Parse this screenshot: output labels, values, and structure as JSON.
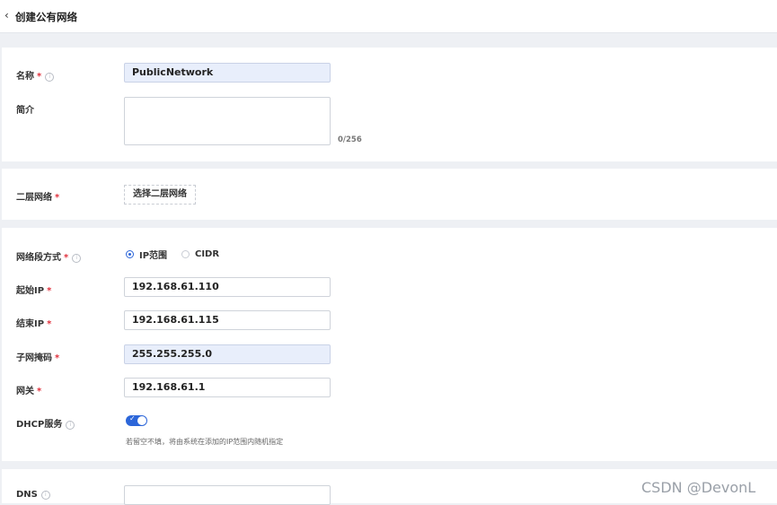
{
  "header": {
    "back_icon": "‹",
    "title": "创建公有网络"
  },
  "basic": {
    "name_label": "名称",
    "name_value": "PublicNetwork",
    "desc_label": "简介",
    "desc_value": "",
    "desc_counter": "0/256"
  },
  "l2": {
    "label": "二层网络",
    "button": "选择二层网络"
  },
  "range": {
    "mode_label": "网络段方式",
    "mode_options": [
      "IP范围",
      "CIDR"
    ],
    "mode_selected": "IP范围",
    "start_label": "起始IP",
    "start_value": "192.168.61.110",
    "end_label": "结束IP",
    "end_value": "192.168.61.115",
    "mask_label": "子网掩码",
    "mask_value": "255.255.255.0",
    "gateway_label": "网关",
    "gateway_value": "192.168.61.1",
    "dhcp_label": "DHCP服务",
    "dhcp_enabled": true,
    "dhcp_hint": "若留空不填，将由系统在添加的IP范围内随机指定"
  },
  "dns": {
    "label": "DNS",
    "value": ""
  },
  "required_mark": "*",
  "info_icon": "i",
  "toggle_check": "✓",
  "watermark": "CSDN @DevonL",
  "colors": {
    "accent": "#2c66d9",
    "required": "#e0303c",
    "filled_input": "#e8eefb"
  }
}
